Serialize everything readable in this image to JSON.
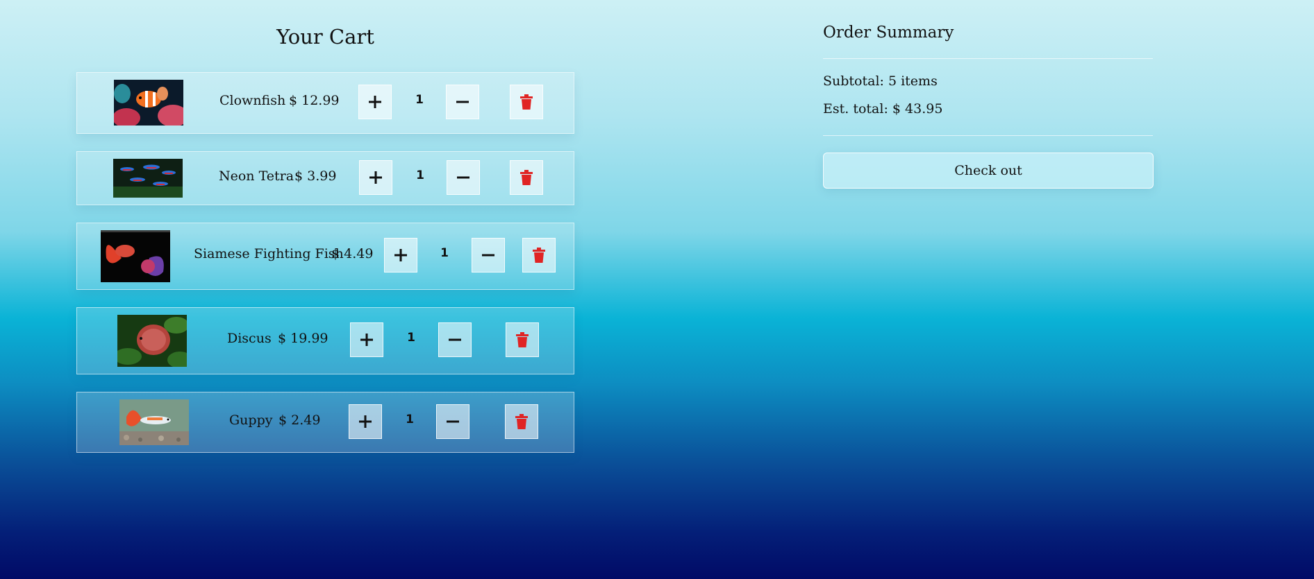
{
  "cart": {
    "title": "Your Cart",
    "items": [
      {
        "name": "Clownfish",
        "price": "$ 12.99",
        "qty": "1",
        "image": "clownfish-photo"
      },
      {
        "name": "Neon Tetra",
        "price": "$ 3.99",
        "qty": "1",
        "image": "neon-tetra-photo"
      },
      {
        "name": "Siamese Fighting Fish",
        "price": "$ 4.49",
        "qty": "1",
        "image": "betta-photo"
      },
      {
        "name": "Discus",
        "price": "$ 19.99",
        "qty": "1",
        "image": "discus-photo"
      },
      {
        "name": "Guppy",
        "price": "$ 2.49",
        "qty": "1",
        "image": "guppy-photo"
      }
    ],
    "icons": {
      "increment": "plus-icon",
      "decrement": "minus-icon",
      "remove": "trash-icon"
    }
  },
  "summary": {
    "title": "Order Summary",
    "subtotal": "Subtotal: 5 items",
    "est_total": "Est. total: $ 43.95",
    "checkout_label": "Check out"
  },
  "colors": {
    "trash": "#e02424",
    "gradient_top": "#cdf0f5",
    "gradient_mid": "#0ab3d6",
    "gradient_bottom": "#010a66"
  }
}
